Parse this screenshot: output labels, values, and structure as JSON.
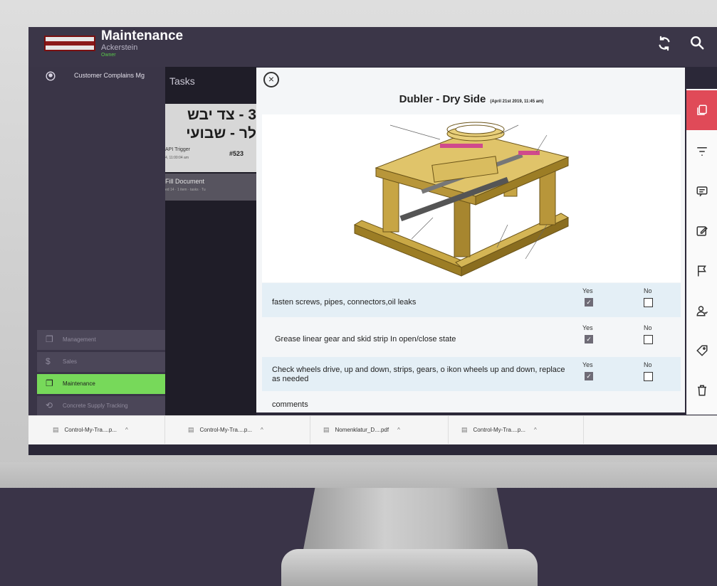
{
  "header": {
    "title": "Maintenance",
    "subtitle": "Ackerstein",
    "role": "Owner",
    "sync_icon": "sync-icon",
    "search_icon": "search-icon"
  },
  "sidebar": {
    "top_item": {
      "label": "Customer Complains Mg",
      "icon": "user-circle-icon"
    },
    "items": [
      {
        "label": "Management",
        "icon": "folders-icon"
      },
      {
        "label": "Sales",
        "icon": "dollar-icon"
      },
      {
        "label": "Maintenance",
        "icon": "folders-icon"
      },
      {
        "label": "Concrete Supply Tracking",
        "icon": "sync-icon"
      }
    ]
  },
  "tasks": {
    "title": "Tasks",
    "card": {
      "line1": "3 - צד יבש",
      "line2": "לר - שבועי",
      "trigger": "API Trigger",
      "time": "4, 11:00:04 am",
      "number": "#523"
    },
    "fill_document": "Fill Document",
    "fill_meta": "ed 14 · 1 item · tasks · Tu"
  },
  "modal": {
    "close_symbol": "×",
    "doc_title": "Dubler - Dry Side",
    "doc_date": "(April 21st 2019, 11:45 am)",
    "rows": [
      {
        "label": "fasten screws, pipes, connectors,oil leaks",
        "yes_label": "Yes",
        "no_label": "No",
        "yes_checked": true,
        "no_checked": false
      },
      {
        "label": "Grease linear gear and skid strip In open/close state",
        "yes_label": "Yes",
        "no_label": "No",
        "yes_checked": true,
        "no_checked": false
      },
      {
        "label": "Check wheels drive, up and down, strips, gears, o ikon wheels up and down, replace as needed",
        "yes_label": "Yes",
        "no_label": "No",
        "yes_checked": true,
        "no_checked": false
      }
    ],
    "comments_label": "comments",
    "check_mark": "✓"
  },
  "toolbar": {
    "icons": [
      "documents-icon",
      "filter-icon",
      "comment-icon",
      "edit-icon",
      "flag-icon",
      "user-assign-icon",
      "tag-icon",
      "trash-icon"
    ]
  },
  "downloads": [
    {
      "name": "Control-My-Tra....p..."
    },
    {
      "name": "Control-My-Tra....p..."
    },
    {
      "name": "Nomenklatur_D....pdf"
    },
    {
      "name": "Control-My-Tra....p..."
    }
  ]
}
